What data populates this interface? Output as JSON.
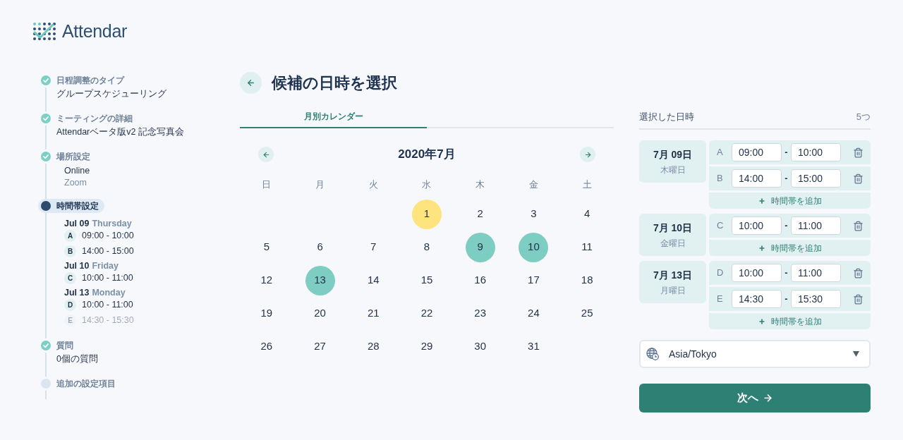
{
  "logo": {
    "text": "Attendar"
  },
  "steps": [
    {
      "completed": true,
      "current": false,
      "label": "日程調整のタイプ",
      "value": "グループスケジューリング"
    },
    {
      "completed": true,
      "current": false,
      "label": "ミーティングの詳細",
      "value": "Attendarベータ版v2 記念写真会"
    },
    {
      "completed": true,
      "current": false,
      "label": "場所設定",
      "location": {
        "type": "Online",
        "service": "Zoom"
      }
    },
    {
      "completed": false,
      "current": true,
      "label": "時間帯設定",
      "dates": [
        {
          "date": "Jul 09",
          "weekday": "Thursday",
          "slots": [
            {
              "letter": "A",
              "time": "09:00 - 10:00",
              "dimmed": false
            },
            {
              "letter": "B",
              "time": "14:00 - 15:00",
              "dimmed": false
            }
          ]
        },
        {
          "date": "Jul 10",
          "weekday": "Friday",
          "slots": [
            {
              "letter": "C",
              "time": "10:00 - 11:00",
              "dimmed": false
            }
          ]
        },
        {
          "date": "Jul 13",
          "weekday": "Monday",
          "slots": [
            {
              "letter": "D",
              "time": "10:00 - 11:00",
              "dimmed": false
            },
            {
              "letter": "E",
              "time": "14:30 - 15:30",
              "dimmed": true
            }
          ]
        }
      ]
    },
    {
      "completed": true,
      "current": false,
      "label": "質問",
      "value": "0個の質問"
    },
    {
      "completed": false,
      "current": false,
      "label": "追加の設定項目"
    }
  ],
  "page_title": "候補の日時を選択",
  "tabs": [
    {
      "label": "月別カレンダー",
      "selected": true
    }
  ],
  "calendar": {
    "title": "2020年7月",
    "weekdays": [
      "日",
      "月",
      "火",
      "水",
      "木",
      "金",
      "土"
    ],
    "weeks": [
      [
        {
          "kind": "blank"
        },
        {
          "kind": "blank"
        },
        {
          "kind": "blank"
        },
        {
          "kind": "day",
          "day": "1",
          "selected": false,
          "today": true
        },
        {
          "kind": "day",
          "day": "2",
          "selected": false,
          "today": false
        },
        {
          "kind": "day",
          "day": "3",
          "selected": false,
          "today": false
        },
        {
          "kind": "day",
          "day": "4",
          "selected": false,
          "today": false
        }
      ],
      [
        {
          "kind": "day",
          "day": "5",
          "selected": false,
          "today": false
        },
        {
          "kind": "day",
          "day": "6",
          "selected": false,
          "today": false
        },
        {
          "kind": "day",
          "day": "7",
          "selected": false,
          "today": false
        },
        {
          "kind": "day",
          "day": "8",
          "selected": false,
          "today": false
        },
        {
          "kind": "day",
          "day": "9",
          "selected": true,
          "today": false
        },
        {
          "kind": "day",
          "day": "10",
          "selected": true,
          "today": false
        },
        {
          "kind": "day",
          "day": "11",
          "selected": false,
          "today": false
        }
      ],
      [
        {
          "kind": "day",
          "day": "12",
          "selected": false,
          "today": false
        },
        {
          "kind": "day",
          "day": "13",
          "selected": true,
          "today": false
        },
        {
          "kind": "day",
          "day": "14",
          "selected": false,
          "today": false
        },
        {
          "kind": "day",
          "day": "15",
          "selected": false,
          "today": false
        },
        {
          "kind": "day",
          "day": "16",
          "selected": false,
          "today": false
        },
        {
          "kind": "day",
          "day": "17",
          "selected": false,
          "today": false
        },
        {
          "kind": "day",
          "day": "18",
          "selected": false,
          "today": false
        }
      ],
      [
        {
          "kind": "day",
          "day": "19",
          "selected": false,
          "today": false
        },
        {
          "kind": "day",
          "day": "20",
          "selected": false,
          "today": false
        },
        {
          "kind": "day",
          "day": "21",
          "selected": false,
          "today": false
        },
        {
          "kind": "day",
          "day": "22",
          "selected": false,
          "today": false
        },
        {
          "kind": "day",
          "day": "23",
          "selected": false,
          "today": false
        },
        {
          "kind": "day",
          "day": "24",
          "selected": false,
          "today": false
        },
        {
          "kind": "day",
          "day": "25",
          "selected": false,
          "today": false
        }
      ],
      [
        {
          "kind": "day",
          "day": "26",
          "selected": false,
          "today": false
        },
        {
          "kind": "day",
          "day": "27",
          "selected": false,
          "today": false
        },
        {
          "kind": "day",
          "day": "28",
          "selected": false,
          "today": false
        },
        {
          "kind": "day",
          "day": "29",
          "selected": false,
          "today": false
        },
        {
          "kind": "day",
          "day": "30",
          "selected": false,
          "today": false
        },
        {
          "kind": "day",
          "day": "31",
          "selected": false,
          "today": false
        },
        {
          "kind": "blank"
        }
      ]
    ]
  },
  "selected_dates": {
    "title": "選択した日時",
    "count": "5つ",
    "groups": [
      {
        "date": "7月 09日",
        "weekday": "木曜日",
        "slots": [
          {
            "letter": "A",
            "start": "09:00",
            "separator": "-",
            "end": "10:00"
          },
          {
            "letter": "B",
            "start": "14:00",
            "separator": "-",
            "end": "15:00"
          }
        ],
        "add_label": "時間帯を追加"
      },
      {
        "date": "7月 10日",
        "weekday": "金曜日",
        "slots": [
          {
            "letter": "C",
            "start": "10:00",
            "separator": "-",
            "end": "11:00"
          }
        ],
        "add_label": "時間帯を追加"
      },
      {
        "date": "7月 13日",
        "weekday": "月曜日",
        "slots": [
          {
            "letter": "D",
            "start": "10:00",
            "separator": "-",
            "end": "11:00"
          },
          {
            "letter": "E",
            "start": "14:30",
            "separator": "-",
            "end": "15:30"
          }
        ],
        "add_label": "時間帯を追加"
      }
    ]
  },
  "timezone": {
    "value": "Asia/Tokyo"
  },
  "next_button": {
    "label": "次へ"
  }
}
